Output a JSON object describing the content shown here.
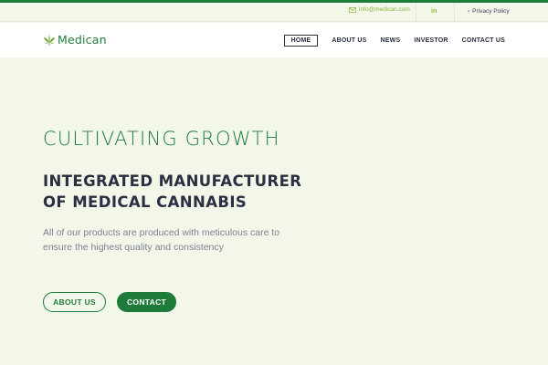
{
  "topbar": {
    "email": "info@medican.com",
    "linkedin_label": "in",
    "privacy_label": "Privacy Policy"
  },
  "brand": {
    "name": "Medican",
    "icon": "cannabis-leaf-icon"
  },
  "nav": {
    "items": [
      {
        "label": "HOME",
        "active": true
      },
      {
        "label": "ABOUT US",
        "active": false
      },
      {
        "label": "NEWS",
        "active": false
      },
      {
        "label": "INVESTOR",
        "active": false
      },
      {
        "label": "CONTACT US",
        "active": false
      }
    ]
  },
  "hero": {
    "tagline": "CULTIVATING GROWTH",
    "title_line1": "INTEGRATED MANUFACTURER",
    "title_line2": "OF MEDICAL CANNABIS",
    "description": "All of our products are produced with meticulous care to ensure the highest quality and consistency",
    "button_about": "ABOUT US",
    "button_contact": "CONTACT"
  },
  "colors": {
    "brand_green": "#1e7b3a",
    "accent_lime": "#8bb63f",
    "background": "#f3f7ea",
    "text_dark": "#2b2f42"
  }
}
